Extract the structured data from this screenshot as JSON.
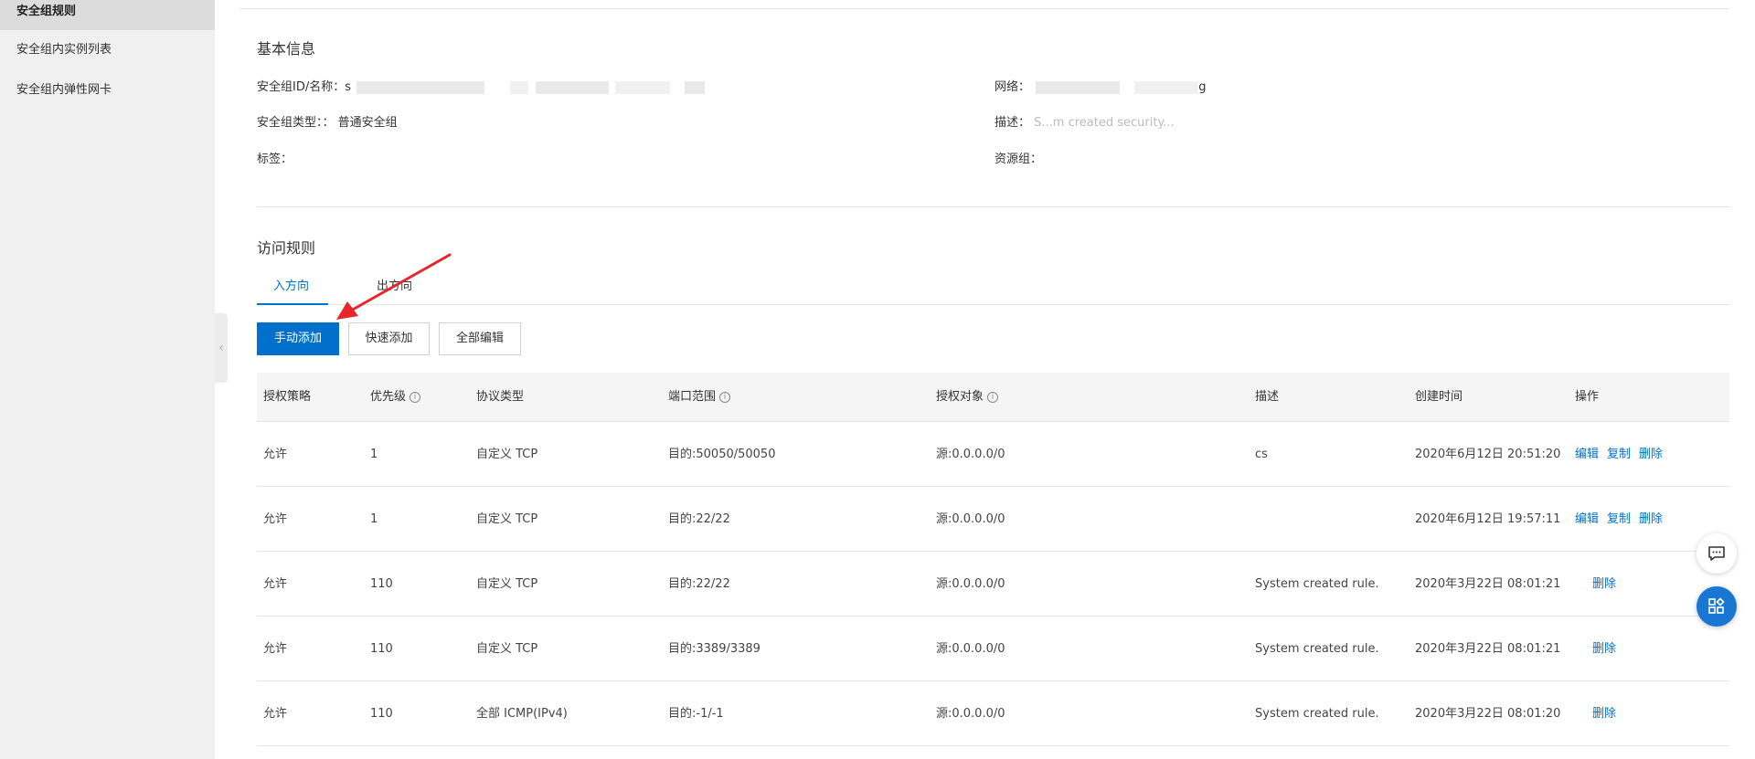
{
  "sidebar": {
    "items": [
      {
        "label": "安全组规则",
        "active": true
      },
      {
        "label": "安全组内实例列表",
        "active": false
      },
      {
        "label": "安全组内弹性网卡",
        "active": false
      }
    ]
  },
  "basic_info": {
    "title": "基本信息",
    "sg_id_label": "安全组ID/名称：",
    "sg_id_value": "s",
    "sg_type_label": "安全组类型：：",
    "sg_type_value": "普通安全组",
    "tags_label": "标签：",
    "network_label": "网络：",
    "network_value": "g",
    "desc_label": "描述：",
    "desc_value": "S...m created security...",
    "resource_group_label": "资源组："
  },
  "access_rules": {
    "title": "访问规则",
    "tabs": [
      {
        "label": "入方向",
        "active": true
      },
      {
        "label": "出方向",
        "active": false
      }
    ],
    "buttons": {
      "manual_add": "手动添加",
      "quick_add": "快速添加",
      "edit_all": "全部编辑"
    },
    "columns": [
      "授权策略",
      "优先级",
      "协议类型",
      "端口范围",
      "授权对象",
      "描述",
      "创建时间",
      "操作"
    ],
    "info_icon_glyph": "i",
    "rows": [
      {
        "policy": "允许",
        "priority": "1",
        "protocol": "自定义 TCP",
        "port": "目的:50050/50050",
        "source": "源:0.0.0.0/0",
        "desc": "cs",
        "time": "2020年6月12日 20:51:20",
        "actions": [
          "编辑",
          "复制",
          "删除"
        ]
      },
      {
        "policy": "允许",
        "priority": "1",
        "protocol": "自定义 TCP",
        "port": "目的:22/22",
        "source": "源:0.0.0.0/0",
        "desc": "",
        "time": "2020年6月12日 19:57:11",
        "actions": [
          "编辑",
          "复制",
          "删除"
        ]
      },
      {
        "policy": "允许",
        "priority": "110",
        "protocol": "自定义 TCP",
        "port": "目的:22/22",
        "source": "源:0.0.0.0/0",
        "desc": "System created rule.",
        "time": "2020年3月22日 08:01:21",
        "actions": [
          "删除"
        ]
      },
      {
        "policy": "允许",
        "priority": "110",
        "protocol": "自定义 TCP",
        "port": "目的:3389/3389",
        "source": "源:0.0.0.0/0",
        "desc": "System created rule.",
        "time": "2020年3月22日 08:01:21",
        "actions": [
          "删除"
        ]
      },
      {
        "policy": "允许",
        "priority": "110",
        "protocol": "全部 ICMP(IPv4)",
        "port": "目的:-1/-1",
        "source": "源:0.0.0.0/0",
        "desc": "System created rule.",
        "time": "2020年3月22日 08:01:20",
        "actions": [
          "删除"
        ]
      }
    ]
  },
  "floating": {
    "chat_icon": "chat-icon",
    "apps_icon": "apps-icon"
  },
  "colors": {
    "accent": "#0070cc",
    "sidebar_bg": "#f0f0f0",
    "annotation_arrow": "#e8252a"
  }
}
